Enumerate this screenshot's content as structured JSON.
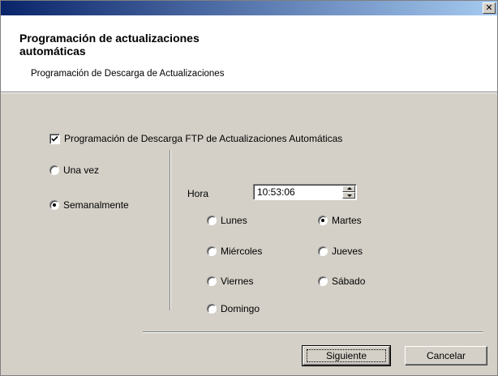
{
  "window": {
    "close_symbol": "✕"
  },
  "header": {
    "title": "Programación de actualizaciones automáticas",
    "subtitle": "Programación de Descarga de Actualizaciones"
  },
  "schedule": {
    "enable_label": "Programación de Descarga FTP de Actualizaciones Automáticas",
    "enable_checked": true,
    "frequency": [
      {
        "label": "Una vez",
        "selected": false
      },
      {
        "label": "Semanalmente",
        "selected": true
      }
    ],
    "hora_label": "Hora",
    "hora_value": "10:53:06",
    "days": [
      {
        "label": "Lunes",
        "selected": false
      },
      {
        "label": "Martes",
        "selected": true
      },
      {
        "label": "Miércoles",
        "selected": false
      },
      {
        "label": "Jueves",
        "selected": false
      },
      {
        "label": "Viernes",
        "selected": false
      },
      {
        "label": "Sábado",
        "selected": false
      },
      {
        "label": "Domingo",
        "selected": false
      }
    ]
  },
  "buttons": {
    "next_label": "Siguiente",
    "cancel_label": "Cancelar"
  },
  "colors": {
    "titlebar_start": "#0a246a",
    "titlebar_end": "#a6caf0",
    "dialog_bg": "#d4d0c8"
  }
}
